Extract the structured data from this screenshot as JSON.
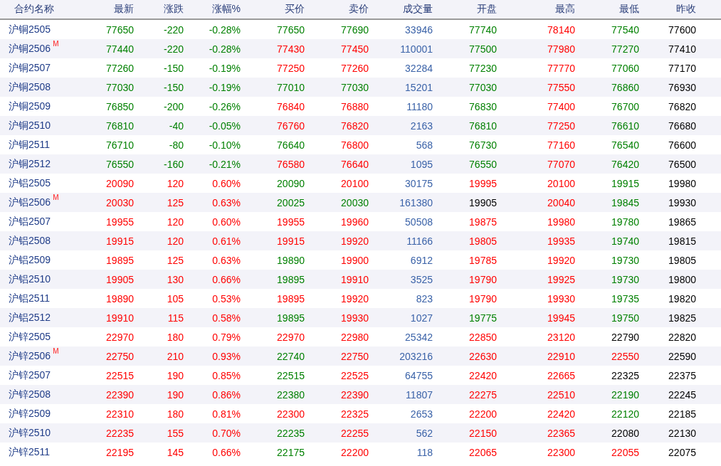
{
  "table": {
    "columns": [
      "合约名称",
      "最新",
      "涨跌",
      "涨幅%",
      "买价",
      "卖价",
      "成交量",
      "开盘",
      "最高",
      "最低",
      "昨收"
    ],
    "rows": [
      {
        "cells": [
          {
            "text": "沪铜2505"
          },
          {
            "text": "77650",
            "color": "#008000"
          },
          {
            "text": "-220",
            "color": "#008000"
          },
          {
            "text": "-0.28%",
            "color": "#008000"
          },
          {
            "text": "77650",
            "color": "#008000"
          },
          {
            "text": "77690",
            "color": "#008000"
          },
          {
            "text": "33946",
            "color": "#3a62a8"
          },
          {
            "text": "77740",
            "color": "#008000"
          },
          {
            "text": "78140",
            "color": "#ff0000"
          },
          {
            "text": "77540",
            "color": "#008000"
          },
          {
            "text": "77600",
            "color": "#000000"
          }
        ]
      },
      {
        "cells": [
          {
            "text": "沪铜2506",
            "badge": "M"
          },
          {
            "text": "77440",
            "color": "#008000"
          },
          {
            "text": "-220",
            "color": "#008000"
          },
          {
            "text": "-0.28%",
            "color": "#008000"
          },
          {
            "text": "77430",
            "color": "#ff0000"
          },
          {
            "text": "77450",
            "color": "#ff0000"
          },
          {
            "text": "110001",
            "color": "#3a62a8"
          },
          {
            "text": "77500",
            "color": "#008000"
          },
          {
            "text": "77980",
            "color": "#ff0000"
          },
          {
            "text": "77270",
            "color": "#008000"
          },
          {
            "text": "77410",
            "color": "#000000"
          }
        ]
      },
      {
        "cells": [
          {
            "text": "沪铜2507"
          },
          {
            "text": "77260",
            "color": "#008000"
          },
          {
            "text": "-150",
            "color": "#008000"
          },
          {
            "text": "-0.19%",
            "color": "#008000"
          },
          {
            "text": "77250",
            "color": "#ff0000"
          },
          {
            "text": "77260",
            "color": "#ff0000"
          },
          {
            "text": "32284",
            "color": "#3a62a8"
          },
          {
            "text": "77230",
            "color": "#008000"
          },
          {
            "text": "77770",
            "color": "#ff0000"
          },
          {
            "text": "77060",
            "color": "#008000"
          },
          {
            "text": "77170",
            "color": "#000000"
          }
        ]
      },
      {
        "cells": [
          {
            "text": "沪铜2508"
          },
          {
            "text": "77030",
            "color": "#008000"
          },
          {
            "text": "-150",
            "color": "#008000"
          },
          {
            "text": "-0.19%",
            "color": "#008000"
          },
          {
            "text": "77010",
            "color": "#008000"
          },
          {
            "text": "77030",
            "color": "#008000"
          },
          {
            "text": "15201",
            "color": "#3a62a8"
          },
          {
            "text": "77030",
            "color": "#008000"
          },
          {
            "text": "77550",
            "color": "#ff0000"
          },
          {
            "text": "76860",
            "color": "#008000"
          },
          {
            "text": "76930",
            "color": "#000000"
          }
        ]
      },
      {
        "cells": [
          {
            "text": "沪铜2509"
          },
          {
            "text": "76850",
            "color": "#008000"
          },
          {
            "text": "-200",
            "color": "#008000"
          },
          {
            "text": "-0.26%",
            "color": "#008000"
          },
          {
            "text": "76840",
            "color": "#ff0000"
          },
          {
            "text": "76880",
            "color": "#ff0000"
          },
          {
            "text": "11180",
            "color": "#3a62a8"
          },
          {
            "text": "76830",
            "color": "#008000"
          },
          {
            "text": "77400",
            "color": "#ff0000"
          },
          {
            "text": "76700",
            "color": "#008000"
          },
          {
            "text": "76820",
            "color": "#000000"
          }
        ]
      },
      {
        "cells": [
          {
            "text": "沪铜2510"
          },
          {
            "text": "76810",
            "color": "#008000"
          },
          {
            "text": "-40",
            "color": "#008000"
          },
          {
            "text": "-0.05%",
            "color": "#008000"
          },
          {
            "text": "76760",
            "color": "#ff0000"
          },
          {
            "text": "76820",
            "color": "#ff0000"
          },
          {
            "text": "2163",
            "color": "#3a62a8"
          },
          {
            "text": "76810",
            "color": "#008000"
          },
          {
            "text": "77250",
            "color": "#ff0000"
          },
          {
            "text": "76610",
            "color": "#008000"
          },
          {
            "text": "76680",
            "color": "#000000"
          }
        ]
      },
      {
        "cells": [
          {
            "text": "沪铜2511"
          },
          {
            "text": "76710",
            "color": "#008000"
          },
          {
            "text": "-80",
            "color": "#008000"
          },
          {
            "text": "-0.10%",
            "color": "#008000"
          },
          {
            "text": "76640",
            "color": "#008000"
          },
          {
            "text": "76800",
            "color": "#ff0000"
          },
          {
            "text": "568",
            "color": "#3a62a8"
          },
          {
            "text": "76730",
            "color": "#008000"
          },
          {
            "text": "77160",
            "color": "#ff0000"
          },
          {
            "text": "76540",
            "color": "#008000"
          },
          {
            "text": "76600",
            "color": "#000000"
          }
        ]
      },
      {
        "cells": [
          {
            "text": "沪铜2512"
          },
          {
            "text": "76550",
            "color": "#008000"
          },
          {
            "text": "-160",
            "color": "#008000"
          },
          {
            "text": "-0.21%",
            "color": "#008000"
          },
          {
            "text": "76580",
            "color": "#ff0000"
          },
          {
            "text": "76640",
            "color": "#ff0000"
          },
          {
            "text": "1095",
            "color": "#3a62a8"
          },
          {
            "text": "76550",
            "color": "#008000"
          },
          {
            "text": "77070",
            "color": "#ff0000"
          },
          {
            "text": "76420",
            "color": "#008000"
          },
          {
            "text": "76500",
            "color": "#000000"
          }
        ]
      },
      {
        "cells": [
          {
            "text": "沪铝2505"
          },
          {
            "text": "20090",
            "color": "#ff0000"
          },
          {
            "text": "120",
            "color": "#ff0000"
          },
          {
            "text": "0.60%",
            "color": "#ff0000"
          },
          {
            "text": "20090",
            "color": "#008000"
          },
          {
            "text": "20100",
            "color": "#ff0000"
          },
          {
            "text": "30175",
            "color": "#3a62a8"
          },
          {
            "text": "19995",
            "color": "#ff0000"
          },
          {
            "text": "20100",
            "color": "#ff0000"
          },
          {
            "text": "19915",
            "color": "#008000"
          },
          {
            "text": "19980",
            "color": "#000000"
          }
        ]
      },
      {
        "cells": [
          {
            "text": "沪铝2506",
            "badge": "M"
          },
          {
            "text": "20030",
            "color": "#ff0000"
          },
          {
            "text": "125",
            "color": "#ff0000"
          },
          {
            "text": "0.63%",
            "color": "#ff0000"
          },
          {
            "text": "20025",
            "color": "#008000"
          },
          {
            "text": "20030",
            "color": "#008000"
          },
          {
            "text": "161380",
            "color": "#3a62a8"
          },
          {
            "text": "19905",
            "color": "#000000"
          },
          {
            "text": "20040",
            "color": "#ff0000"
          },
          {
            "text": "19845",
            "color": "#008000"
          },
          {
            "text": "19930",
            "color": "#000000"
          }
        ]
      },
      {
        "cells": [
          {
            "text": "沪铝2507"
          },
          {
            "text": "19955",
            "color": "#ff0000"
          },
          {
            "text": "120",
            "color": "#ff0000"
          },
          {
            "text": "0.60%",
            "color": "#ff0000"
          },
          {
            "text": "19955",
            "color": "#ff0000"
          },
          {
            "text": "19960",
            "color": "#ff0000"
          },
          {
            "text": "50508",
            "color": "#3a62a8"
          },
          {
            "text": "19875",
            "color": "#ff0000"
          },
          {
            "text": "19980",
            "color": "#ff0000"
          },
          {
            "text": "19780",
            "color": "#008000"
          },
          {
            "text": "19865",
            "color": "#000000"
          }
        ]
      },
      {
        "cells": [
          {
            "text": "沪铝2508"
          },
          {
            "text": "19915",
            "color": "#ff0000"
          },
          {
            "text": "120",
            "color": "#ff0000"
          },
          {
            "text": "0.61%",
            "color": "#ff0000"
          },
          {
            "text": "19915",
            "color": "#ff0000"
          },
          {
            "text": "19920",
            "color": "#ff0000"
          },
          {
            "text": "11166",
            "color": "#3a62a8"
          },
          {
            "text": "19805",
            "color": "#ff0000"
          },
          {
            "text": "19935",
            "color": "#ff0000"
          },
          {
            "text": "19740",
            "color": "#008000"
          },
          {
            "text": "19815",
            "color": "#000000"
          }
        ]
      },
      {
        "cells": [
          {
            "text": "沪铝2509"
          },
          {
            "text": "19895",
            "color": "#ff0000"
          },
          {
            "text": "125",
            "color": "#ff0000"
          },
          {
            "text": "0.63%",
            "color": "#ff0000"
          },
          {
            "text": "19890",
            "color": "#008000"
          },
          {
            "text": "19900",
            "color": "#ff0000"
          },
          {
            "text": "6912",
            "color": "#3a62a8"
          },
          {
            "text": "19785",
            "color": "#ff0000"
          },
          {
            "text": "19920",
            "color": "#ff0000"
          },
          {
            "text": "19730",
            "color": "#008000"
          },
          {
            "text": "19805",
            "color": "#000000"
          }
        ]
      },
      {
        "cells": [
          {
            "text": "沪铝2510"
          },
          {
            "text": "19905",
            "color": "#ff0000"
          },
          {
            "text": "130",
            "color": "#ff0000"
          },
          {
            "text": "0.66%",
            "color": "#ff0000"
          },
          {
            "text": "19895",
            "color": "#008000"
          },
          {
            "text": "19910",
            "color": "#ff0000"
          },
          {
            "text": "3525",
            "color": "#3a62a8"
          },
          {
            "text": "19790",
            "color": "#ff0000"
          },
          {
            "text": "19925",
            "color": "#ff0000"
          },
          {
            "text": "19730",
            "color": "#008000"
          },
          {
            "text": "19800",
            "color": "#000000"
          }
        ]
      },
      {
        "cells": [
          {
            "text": "沪铝2511"
          },
          {
            "text": "19890",
            "color": "#ff0000"
          },
          {
            "text": "105",
            "color": "#ff0000"
          },
          {
            "text": "0.53%",
            "color": "#ff0000"
          },
          {
            "text": "19895",
            "color": "#ff0000"
          },
          {
            "text": "19920",
            "color": "#ff0000"
          },
          {
            "text": "823",
            "color": "#3a62a8"
          },
          {
            "text": "19790",
            "color": "#ff0000"
          },
          {
            "text": "19930",
            "color": "#ff0000"
          },
          {
            "text": "19735",
            "color": "#008000"
          },
          {
            "text": "19820",
            "color": "#000000"
          }
        ]
      },
      {
        "cells": [
          {
            "text": "沪铝2512"
          },
          {
            "text": "19910",
            "color": "#ff0000"
          },
          {
            "text": "115",
            "color": "#ff0000"
          },
          {
            "text": "0.58%",
            "color": "#ff0000"
          },
          {
            "text": "19895",
            "color": "#008000"
          },
          {
            "text": "19930",
            "color": "#ff0000"
          },
          {
            "text": "1027",
            "color": "#3a62a8"
          },
          {
            "text": "19775",
            "color": "#008000"
          },
          {
            "text": "19945",
            "color": "#ff0000"
          },
          {
            "text": "19750",
            "color": "#008000"
          },
          {
            "text": "19825",
            "color": "#000000"
          }
        ]
      },
      {
        "cells": [
          {
            "text": "沪锌2505"
          },
          {
            "text": "22970",
            "color": "#ff0000"
          },
          {
            "text": "180",
            "color": "#ff0000"
          },
          {
            "text": "0.79%",
            "color": "#ff0000"
          },
          {
            "text": "22970",
            "color": "#ff0000"
          },
          {
            "text": "22980",
            "color": "#ff0000"
          },
          {
            "text": "25342",
            "color": "#3a62a8"
          },
          {
            "text": "22850",
            "color": "#ff0000"
          },
          {
            "text": "23120",
            "color": "#ff0000"
          },
          {
            "text": "22790",
            "color": "#000000"
          },
          {
            "text": "22820",
            "color": "#000000"
          }
        ]
      },
      {
        "cells": [
          {
            "text": "沪锌2506",
            "badge": "M"
          },
          {
            "text": "22750",
            "color": "#ff0000"
          },
          {
            "text": "210",
            "color": "#ff0000"
          },
          {
            "text": "0.93%",
            "color": "#ff0000"
          },
          {
            "text": "22740",
            "color": "#008000"
          },
          {
            "text": "22750",
            "color": "#ff0000"
          },
          {
            "text": "203216",
            "color": "#3a62a8"
          },
          {
            "text": "22630",
            "color": "#ff0000"
          },
          {
            "text": "22910",
            "color": "#ff0000"
          },
          {
            "text": "22550",
            "color": "#ff0000"
          },
          {
            "text": "22590",
            "color": "#000000"
          }
        ]
      },
      {
        "cells": [
          {
            "text": "沪锌2507"
          },
          {
            "text": "22515",
            "color": "#ff0000"
          },
          {
            "text": "190",
            "color": "#ff0000"
          },
          {
            "text": "0.85%",
            "color": "#ff0000"
          },
          {
            "text": "22515",
            "color": "#008000"
          },
          {
            "text": "22525",
            "color": "#ff0000"
          },
          {
            "text": "64755",
            "color": "#3a62a8"
          },
          {
            "text": "22420",
            "color": "#ff0000"
          },
          {
            "text": "22665",
            "color": "#ff0000"
          },
          {
            "text": "22325",
            "color": "#000000"
          },
          {
            "text": "22375",
            "color": "#000000"
          }
        ]
      },
      {
        "cells": [
          {
            "text": "沪锌2508"
          },
          {
            "text": "22390",
            "color": "#ff0000"
          },
          {
            "text": "190",
            "color": "#ff0000"
          },
          {
            "text": "0.86%",
            "color": "#ff0000"
          },
          {
            "text": "22380",
            "color": "#008000"
          },
          {
            "text": "22390",
            "color": "#ff0000"
          },
          {
            "text": "11807",
            "color": "#3a62a8"
          },
          {
            "text": "22275",
            "color": "#ff0000"
          },
          {
            "text": "22510",
            "color": "#ff0000"
          },
          {
            "text": "22190",
            "color": "#008000"
          },
          {
            "text": "22245",
            "color": "#000000"
          }
        ]
      },
      {
        "cells": [
          {
            "text": "沪锌2509"
          },
          {
            "text": "22310",
            "color": "#ff0000"
          },
          {
            "text": "180",
            "color": "#ff0000"
          },
          {
            "text": "0.81%",
            "color": "#ff0000"
          },
          {
            "text": "22300",
            "color": "#ff0000"
          },
          {
            "text": "22325",
            "color": "#ff0000"
          },
          {
            "text": "2653",
            "color": "#3a62a8"
          },
          {
            "text": "22200",
            "color": "#ff0000"
          },
          {
            "text": "22420",
            "color": "#ff0000"
          },
          {
            "text": "22120",
            "color": "#008000"
          },
          {
            "text": "22185",
            "color": "#000000"
          }
        ]
      },
      {
        "cells": [
          {
            "text": "沪锌2510"
          },
          {
            "text": "22235",
            "color": "#ff0000"
          },
          {
            "text": "155",
            "color": "#ff0000"
          },
          {
            "text": "0.70%",
            "color": "#ff0000"
          },
          {
            "text": "22235",
            "color": "#008000"
          },
          {
            "text": "22255",
            "color": "#ff0000"
          },
          {
            "text": "562",
            "color": "#3a62a8"
          },
          {
            "text": "22150",
            "color": "#ff0000"
          },
          {
            "text": "22365",
            "color": "#ff0000"
          },
          {
            "text": "22080",
            "color": "#000000"
          },
          {
            "text": "22130",
            "color": "#000000"
          }
        ]
      },
      {
        "cells": [
          {
            "text": "沪锌2511"
          },
          {
            "text": "22195",
            "color": "#ff0000"
          },
          {
            "text": "145",
            "color": "#ff0000"
          },
          {
            "text": "0.66%",
            "color": "#ff0000"
          },
          {
            "text": "22175",
            "color": "#008000"
          },
          {
            "text": "22200",
            "color": "#ff0000"
          },
          {
            "text": "118",
            "color": "#3a62a8"
          },
          {
            "text": "22065",
            "color": "#ff0000"
          },
          {
            "text": "22300",
            "color": "#ff0000"
          },
          {
            "text": "22055",
            "color": "#ff0000"
          },
          {
            "text": "22075",
            "color": "#000000"
          }
        ]
      }
    ]
  }
}
